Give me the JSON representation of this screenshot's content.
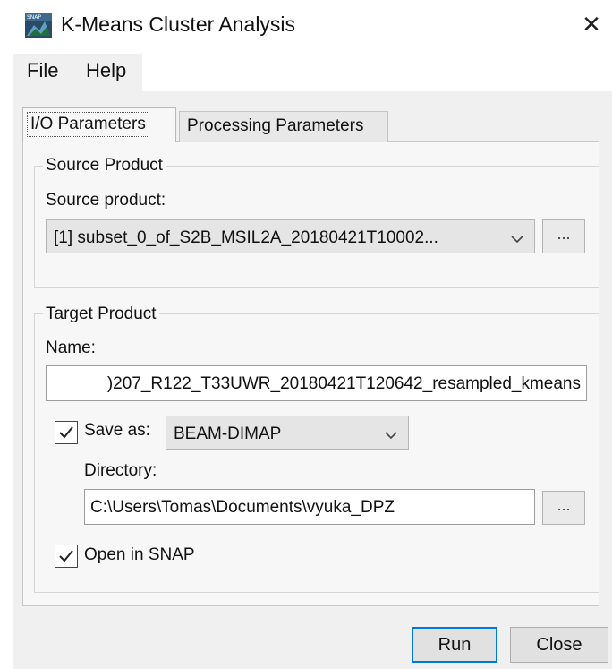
{
  "window": {
    "title": "K-Means Cluster Analysis",
    "app_icon": "snap-app-icon",
    "close_icon": "close-icon"
  },
  "menu": {
    "file": "File",
    "help": "Help"
  },
  "tabs": [
    {
      "label": "I/O Parameters",
      "active": true
    },
    {
      "label": "Processing Parameters",
      "active": false
    }
  ],
  "source_product": {
    "group_title": "Source Product",
    "label": "Source product:",
    "selected": "[1] subset_0_of_S2B_MSIL2A_20180421T10002...",
    "browse_label": "..."
  },
  "target_product": {
    "group_title": "Target Product",
    "name_label": "Name:",
    "name_value": ")207_R122_T33UWR_20180421T120642_resampled_kmeans",
    "save_as": {
      "label": "Save as:",
      "checked": true,
      "format": "BEAM-DIMAP"
    },
    "directory_label": "Directory:",
    "directory_value": "C:\\Users\\Tomas\\Documents\\vyuka_DPZ",
    "browse_label": "...",
    "open_in_snap": {
      "label": "Open in SNAP",
      "checked": true
    }
  },
  "buttons": {
    "run": "Run",
    "close": "Close"
  },
  "colors": {
    "panel_bg": "#f0f0f0",
    "focus_border": "#0078d7"
  }
}
